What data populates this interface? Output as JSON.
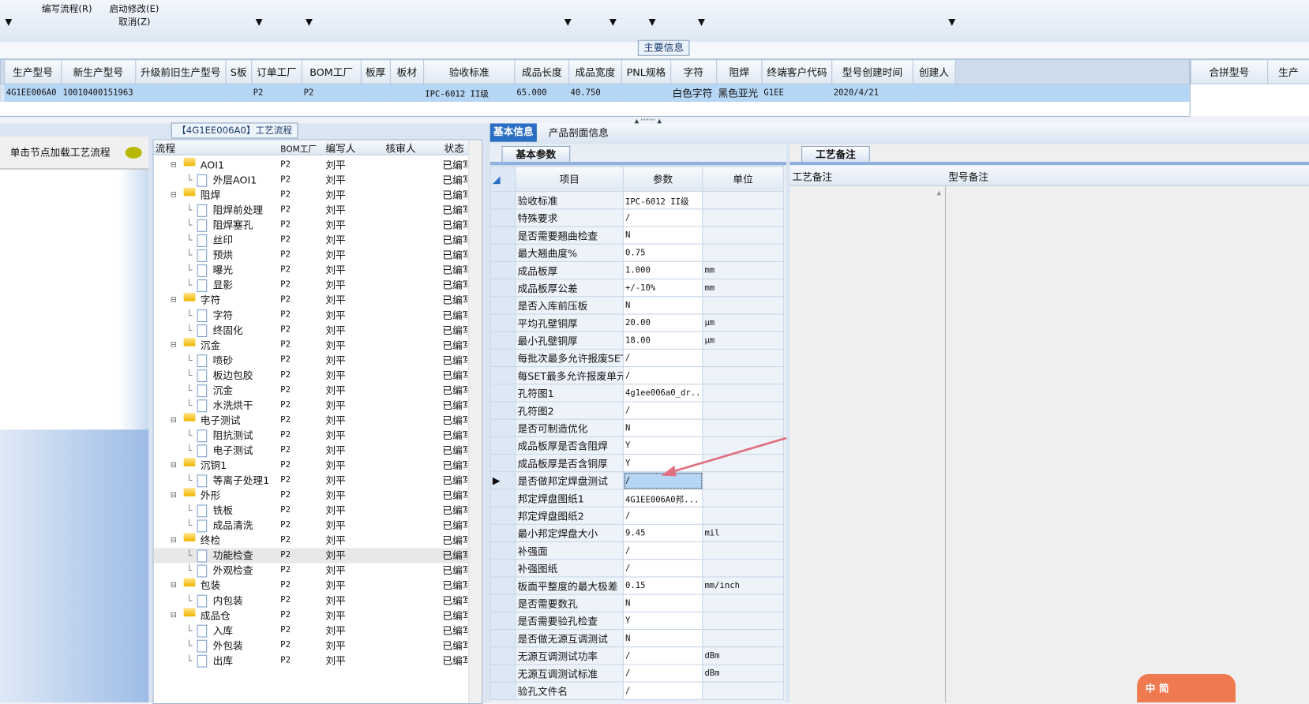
{
  "ribbon": {
    "write_flow": "编写流程(R)",
    "start_modify": "启动修改(E)",
    "cancel": "取消(Z)"
  },
  "main_info_tab": "主要信息",
  "header_table": {
    "columns": [
      "生产型号",
      "新生产型号",
      "升级前旧生产型号",
      "S板",
      "订单工厂",
      "BOM工厂",
      "板厚",
      "板材",
      "验收标准",
      "成品长度",
      "成品宽度",
      "PNL规格",
      "字符",
      "阻焊",
      "终端客户代码",
      "型号创建时间",
      "创建人"
    ],
    "row": [
      "4G1EE006A0",
      "10010400151963",
      "",
      "",
      "P2",
      "P2",
      "",
      "",
      "IPC-6012 II级",
      "65.000",
      "40.750",
      "",
      "白色字符",
      "黑色亚光",
      "G1EE",
      "2020/4/21",
      ""
    ]
  },
  "merge_panel": {
    "columns": [
      "合拼型号",
      "生产"
    ]
  },
  "left_panel": {
    "hint": "单击节点加载工艺流程"
  },
  "flow": {
    "title": "【4G1EE006A0】工艺流程",
    "columns": [
      "流程",
      "BOM工厂",
      "编写人",
      "核审人",
      "状态"
    ],
    "rows": [
      {
        "name": "AOI1",
        "folder": true,
        "bom": "P2",
        "author": "刘平",
        "status": "已编写"
      },
      {
        "name": "外层AOI1",
        "folder": false,
        "bom": "P2",
        "author": "刘平",
        "status": "已编写"
      },
      {
        "name": "阻焊",
        "folder": true,
        "bom": "P2",
        "author": "刘平",
        "status": "已编写"
      },
      {
        "name": "阻焊前处理",
        "folder": false,
        "bom": "P2",
        "author": "刘平",
        "status": "已编写"
      },
      {
        "name": "阻焊塞孔",
        "folder": false,
        "bom": "P2",
        "author": "刘平",
        "status": "已编写"
      },
      {
        "name": "丝印",
        "folder": false,
        "bom": "P2",
        "author": "刘平",
        "status": "已编写"
      },
      {
        "name": "预烘",
        "folder": false,
        "bom": "P2",
        "author": "刘平",
        "status": "已编写"
      },
      {
        "name": "曝光",
        "folder": false,
        "bom": "P2",
        "author": "刘平",
        "status": "已编写"
      },
      {
        "name": "显影",
        "folder": false,
        "bom": "P2",
        "author": "刘平",
        "status": "已编写"
      },
      {
        "name": "字符",
        "folder": true,
        "bom": "P2",
        "author": "刘平",
        "status": "已编写"
      },
      {
        "name": "字符",
        "folder": false,
        "bom": "P2",
        "author": "刘平",
        "status": "已编写"
      },
      {
        "name": "终固化",
        "folder": false,
        "bom": "P2",
        "author": "刘平",
        "status": "已编写"
      },
      {
        "name": "沉金",
        "folder": true,
        "bom": "P2",
        "author": "刘平",
        "status": "已编写"
      },
      {
        "name": "喷砂",
        "folder": false,
        "bom": "P2",
        "author": "刘平",
        "status": "已编写"
      },
      {
        "name": "板边包胶",
        "folder": false,
        "bom": "P2",
        "author": "刘平",
        "status": "已编写"
      },
      {
        "name": "沉金",
        "folder": false,
        "bom": "P2",
        "author": "刘平",
        "status": "已编写"
      },
      {
        "name": "水洗烘干",
        "folder": false,
        "bom": "P2",
        "author": "刘平",
        "status": "已编写"
      },
      {
        "name": "电子测试",
        "folder": true,
        "bom": "P2",
        "author": "刘平",
        "status": "已编写"
      },
      {
        "name": "阻抗测试",
        "folder": false,
        "bom": "P2",
        "author": "刘平",
        "status": "已编写"
      },
      {
        "name": "电子测试",
        "folder": false,
        "bom": "P2",
        "author": "刘平",
        "status": "已编写"
      },
      {
        "name": "沉铜1",
        "folder": true,
        "bom": "P2",
        "author": "刘平",
        "status": "已编写"
      },
      {
        "name": "等离子处理1",
        "folder": false,
        "bom": "P2",
        "author": "刘平",
        "status": "已编写"
      },
      {
        "name": "外形",
        "folder": true,
        "bom": "P2",
        "author": "刘平",
        "status": "已编写"
      },
      {
        "name": "铣板",
        "folder": false,
        "bom": "P2",
        "author": "刘平",
        "status": "已编写"
      },
      {
        "name": "成品清洗",
        "folder": false,
        "bom": "P2",
        "author": "刘平",
        "status": "已编写"
      },
      {
        "name": "终检",
        "folder": true,
        "bom": "P2",
        "author": "刘平",
        "status": "已编写"
      },
      {
        "name": "功能检查",
        "folder": false,
        "bom": "P2",
        "author": "刘平",
        "status": "已编写"
      },
      {
        "name": "外观检查",
        "folder": false,
        "bom": "P2",
        "author": "刘平",
        "status": "已编写"
      },
      {
        "name": "包装",
        "folder": true,
        "bom": "P2",
        "author": "刘平",
        "status": "已编写"
      },
      {
        "name": "内包装",
        "folder": false,
        "bom": "P2",
        "author": "刘平",
        "status": "已编写"
      },
      {
        "name": "成品仓",
        "folder": true,
        "bom": "P2",
        "author": "刘平",
        "status": "已编写"
      },
      {
        "name": "入库",
        "folder": false,
        "bom": "P2",
        "author": "刘平",
        "status": "已编写"
      },
      {
        "name": "外包装",
        "folder": false,
        "bom": "P2",
        "author": "刘平",
        "status": "已编写"
      },
      {
        "name": "出库",
        "folder": false,
        "bom": "P2",
        "author": "刘平",
        "status": "已编写"
      }
    ]
  },
  "info_tabs": [
    "基本信息",
    "产品剖面信息"
  ],
  "params": {
    "tab": "基本参数",
    "columns": [
      "项目",
      "参数",
      "单位"
    ],
    "rows": [
      [
        "验收标准",
        "IPC-6012 II级",
        ""
      ],
      [
        "特殊要求",
        "/",
        ""
      ],
      [
        "是否需要翘曲检查",
        "N",
        ""
      ],
      [
        "最大翘曲度%",
        "0.75",
        ""
      ],
      [
        "成品板厚",
        "1.000",
        "mm"
      ],
      [
        "成品板厚公差",
        "+/-10%",
        "mm"
      ],
      [
        "是否入库前压板",
        "N",
        ""
      ],
      [
        "平均孔壁铜厚",
        "20.00",
        "μm"
      ],
      [
        "最小孔壁铜厚",
        "18.00",
        "μm"
      ],
      [
        "每批次最多允许报废SET",
        "/",
        ""
      ],
      [
        "每SET最多允许报废单元",
        "/",
        ""
      ],
      [
        "孔符图1",
        "4g1ee006a0_dr...",
        ""
      ],
      [
        "孔符图2",
        "/",
        ""
      ],
      [
        "是否可制造优化",
        "N",
        ""
      ],
      [
        "成品板厚是否含阻焊",
        "Y",
        ""
      ],
      [
        "成品板厚是否含铜厚",
        "Y",
        ""
      ],
      [
        "是否做邦定焊盘测试",
        "/",
        ""
      ],
      [
        "邦定焊盘图纸1",
        "4G1EE006A0邦...",
        ""
      ],
      [
        "邦定焊盘图纸2",
        "/",
        ""
      ],
      [
        "最小邦定焊盘大小",
        "9.45",
        "mil"
      ],
      [
        "补强面",
        "/",
        ""
      ],
      [
        "补强图纸",
        "/",
        ""
      ],
      [
        "板面平整度的最大极差",
        "0.15",
        "mm/inch"
      ],
      [
        "是否需要数孔",
        "N",
        ""
      ],
      [
        "是否需要验孔检查",
        "Y",
        ""
      ],
      [
        "是否做无源互调测试",
        "N",
        ""
      ],
      [
        "无源互调测试功率",
        "/",
        "dBm"
      ],
      [
        "无源互调测试标准",
        "/",
        "dBm"
      ],
      [
        "验孔文件名",
        "/",
        ""
      ]
    ],
    "current_row": 16
  },
  "remarks": {
    "tab": "工艺备注",
    "columns": [
      "工艺备注",
      "型号备注"
    ]
  },
  "mascot_text": "中 简"
}
